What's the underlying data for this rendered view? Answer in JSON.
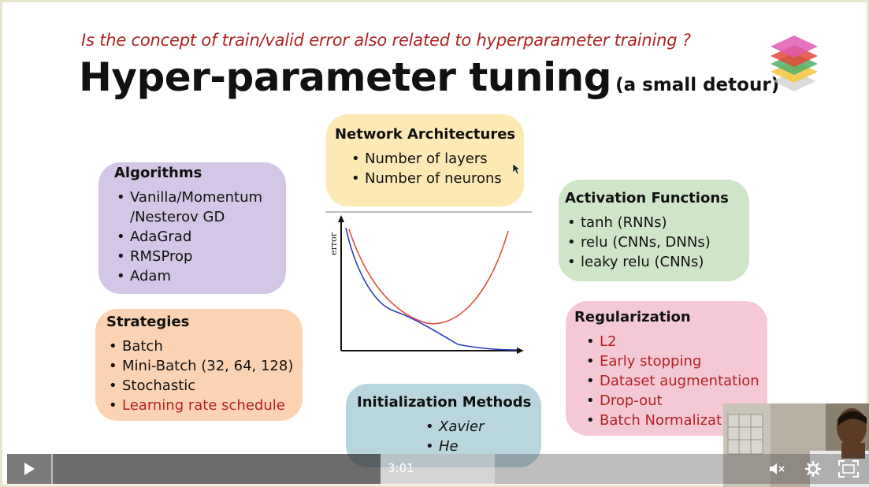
{
  "slide": {
    "question": "Is the concept of train/valid error also related to hyperparameter training ?",
    "title": "Hyper-parameter tuning",
    "subtitle": "(a small detour)"
  },
  "boxes": {
    "algorithms": {
      "heading": "Algorithms",
      "items": [
        "Vanilla/Momentum /Nesterov GD",
        "AdaGrad",
        "RMSProp",
        "Adam"
      ]
    },
    "network": {
      "heading": "Network Architectures",
      "items": [
        "Number of layers",
        "Number of neurons"
      ]
    },
    "activation": {
      "heading": "Activation Functions",
      "items": [
        "tanh (RNNs)",
        "relu (CNNs, DNNs)",
        "leaky relu (CNNs)"
      ]
    },
    "strategies": {
      "heading": "Strategies",
      "items": [
        "Batch",
        "Mini-Batch (32, 64, 128)",
        "Stochastic",
        "Learning rate schedule"
      ]
    },
    "regularization": {
      "heading": "Regularization",
      "items": [
        "L2",
        "Early stopping",
        "Dataset augmentation",
        "Drop-out",
        "Batch Normalizat"
      ]
    },
    "initialization": {
      "heading": "Initialization Methods",
      "items": [
        "Xavier",
        "He"
      ]
    }
  },
  "plot": {
    "ylabel": "error"
  },
  "player": {
    "timecode": "3:01",
    "progress_fraction": 0.49,
    "buffered_fraction": 0.66,
    "icons": [
      "play-icon",
      "volume-muted-icon",
      "settings-gear-icon",
      "fullscreen-icon"
    ]
  },
  "colors": {
    "red_text": "#b22222",
    "algorithms_bg": "#d4c6e6",
    "network_bg": "#fde9b3",
    "activation_bg": "#cfe5c7",
    "strategies_bg": "#fcd3b2",
    "regularization_bg": "#f5c8d6",
    "initialization_bg": "#b9d6df",
    "validation_curve": "#e0503a",
    "training_curve": "#2a3fbf"
  }
}
